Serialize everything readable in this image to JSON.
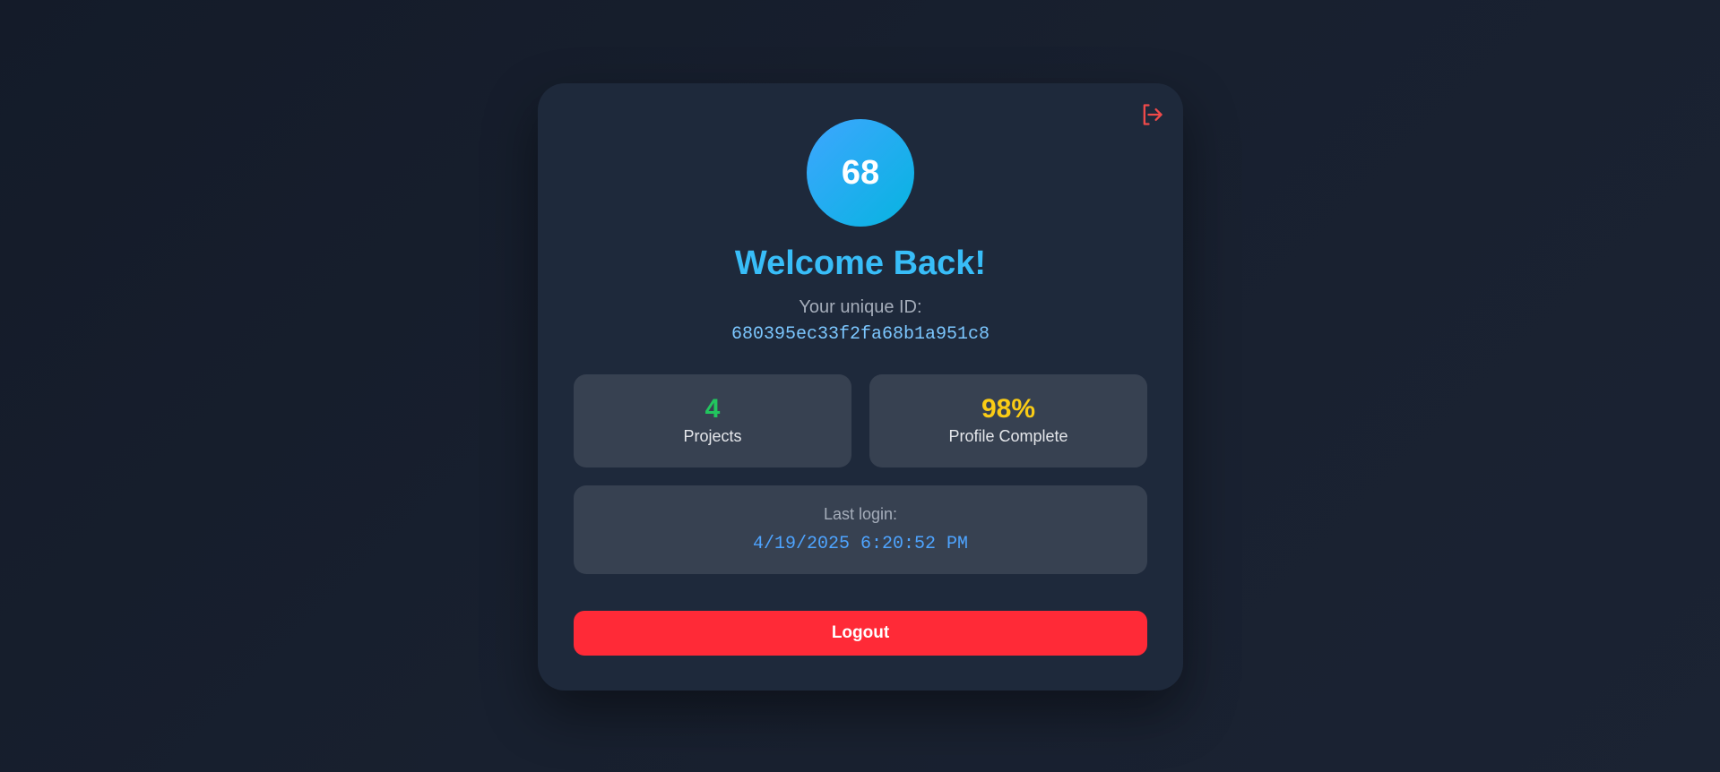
{
  "profile": {
    "avatar_text": "68",
    "welcome_title": "Welcome Back!",
    "id_label": "Your unique ID:",
    "id_value": "680395ec33f2fa68b1a951c8"
  },
  "stats": [
    {
      "value": "4",
      "label": "Projects",
      "color": "#22c55e"
    },
    {
      "value": "98%",
      "label": "Profile Complete",
      "color": "#facc15"
    }
  ],
  "last_login": {
    "label": "Last login:",
    "value": "4/19/2025 6:20:52 PM"
  },
  "actions": {
    "logout_label": "Logout",
    "logout_icon": "logout-icon"
  },
  "colors": {
    "accent": "#38bdf8",
    "danger": "#ff2a37",
    "card_bg": "#1e293b",
    "panel_bg": "#374151"
  }
}
